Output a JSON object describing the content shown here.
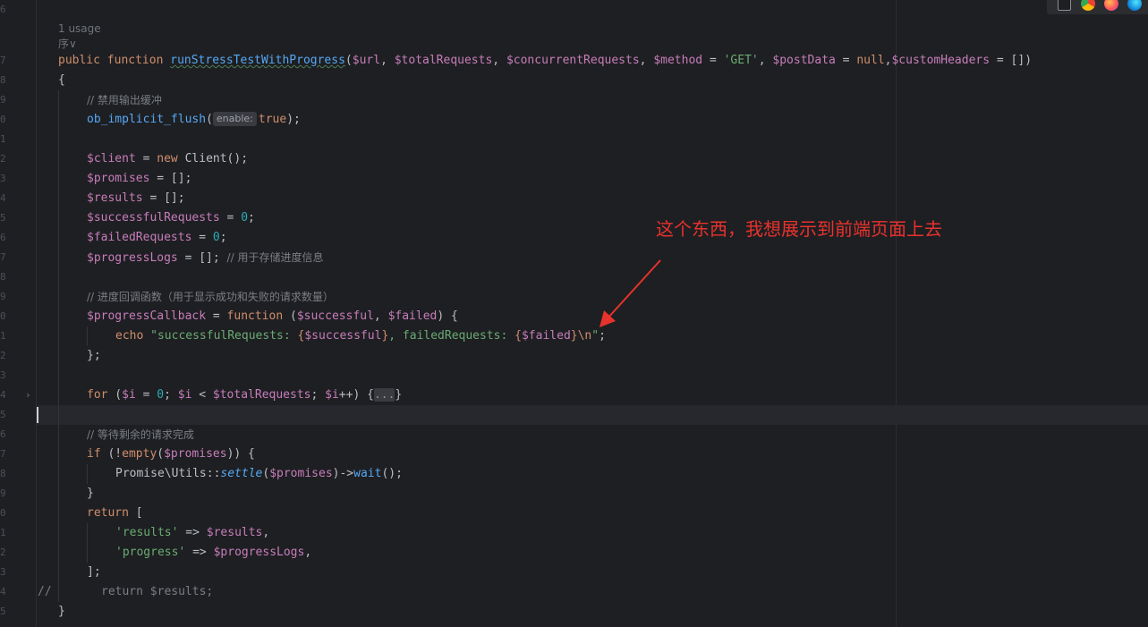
{
  "hint_usage": "1 usage",
  "hint_author": "序∨",
  "gutter_digits": [
    "6",
    "7",
    "8",
    "9",
    "0",
    "1",
    "2",
    "3",
    "4",
    "5",
    "6",
    "7",
    "8",
    "9",
    "0",
    "1",
    "2",
    "3",
    "4",
    "5",
    "6",
    "7",
    "8",
    "9",
    "0",
    "1",
    "2",
    "3",
    "4",
    "5",
    "6",
    "7"
  ],
  "code": {
    "sig": {
      "kw_public": "public",
      "kw_function": "function",
      "fn_name": "runStressTestWithProgress",
      "p_open": "(",
      "v_url": "$url",
      "sep1": ", ",
      "v_total": "$totalRequests",
      "sep2": ", ",
      "v_conc": "$concurrentRequests",
      "sep3": ", ",
      "v_method": "$method",
      "eq1": " = ",
      "s_get": "'GET'",
      "sep4": ", ",
      "v_post": "$postData",
      "eq2": " = ",
      "k_null": "null",
      "sep5": ",",
      "v_headers": "$customHeaders",
      "tail": " = [])"
    },
    "brace_open": "{",
    "c_disable_buffer": "// 禁用输出缓冲",
    "flush": {
      "fn": "ob_implicit_flush",
      "open": "(",
      "param_hint": "enable:",
      "val": "true",
      "close": ");"
    },
    "client": {
      "var": "$client",
      "eq": " = ",
      "kw_new": "new",
      "rest": " Client();"
    },
    "promises": {
      "var": "$promises",
      "rest": " = [];"
    },
    "results": {
      "var": "$results",
      "rest": " = [];"
    },
    "successful": {
      "var": "$successfulRequests",
      "eq": " = ",
      "num": "0",
      "end": ";"
    },
    "failed": {
      "var": "$failedRequests",
      "eq": " = ",
      "num": "0",
      "end": ";"
    },
    "logs": {
      "var": "$progressLogs",
      "rest": " = []; ",
      "comment": "// 用于存储进度信息"
    },
    "c_callback": "// 进度回调函数（用于显示成功和失败的请求数量）",
    "callback": {
      "var": "$progressCallback",
      "eq": " = ",
      "kw_function": "function",
      "open": " (",
      "p1": "$successful",
      "sep": ", ",
      "p2": "$failed",
      "close": ") {"
    },
    "echo": {
      "kw": "echo",
      "sp": " ",
      "s1": "\"successfulRequests: ",
      "b1": "{",
      "v1": "$successful",
      "b2": "}",
      "s2": ", failedRequests: ",
      "b3": "{",
      "v2": "$failed",
      "b4": "}",
      "esc": "\\n",
      "q": "\"",
      "end": ";"
    },
    "cb_close": "};",
    "for": {
      "kw": "for",
      "open": " (",
      "v_i": "$i",
      "eq": " = ",
      "zero": "0",
      "semi": "; ",
      "v_i2": "$i",
      "lt": " < ",
      "v_total": "$totalRequests",
      "semi2": "; ",
      "v_i3": "$i",
      "inc": "++) {",
      "folded": "...",
      "close": "}"
    },
    "c_wait": "// 等待剩余的请求完成",
    "if": {
      "kw": "if",
      "open": " (!",
      "fn": "empty",
      "p": "(",
      "v": "$promises",
      "close": ")) {"
    },
    "settle": {
      "pre": "Promise\\Utils::",
      "method": "settle",
      "open": "(",
      "v": "$promises",
      "arrow": ")->",
      "wait": "wait",
      "end": "();"
    },
    "if_close": "}",
    "ret": {
      "kw": "return",
      "rest": " ["
    },
    "ret_results": {
      "key": "'results'",
      "arrow": " => ",
      "v": "$results",
      "end": ","
    },
    "ret_progress": {
      "key": "'progress'",
      "arrow": " => ",
      "v": "$progressLogs",
      "end": ","
    },
    "ret_close": "];",
    "commented_return": {
      "slashes": "//",
      "text": "return $results;"
    },
    "brace_close": "}"
  },
  "annotation": "这个东西，我想展示到前端页面上去",
  "colors": {
    "background": "#1e1f22",
    "keyword": "#cf8e6d",
    "function": "#56a8f5",
    "variable": "#c77dbb",
    "string": "#6aab73",
    "number": "#2aacb8",
    "comment": "#7a7e85",
    "annotation": "#e8322d"
  },
  "tray_icons": [
    "ide-icon",
    "chrome-icon",
    "firefox-icon",
    "edge-icon"
  ]
}
